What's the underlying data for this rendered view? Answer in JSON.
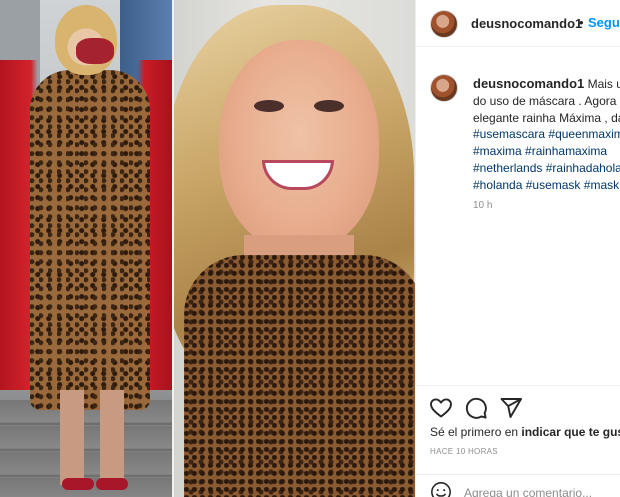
{
  "post": {
    "username": "deusnocomando1",
    "dot": "•",
    "follow_label": "Seguir"
  },
  "caption": {
    "username": "deusnocomando1",
    "lines": [
      "Mais um",
      "do uso de máscara . Agora v",
      "elegante rainha Máxima , da"
    ],
    "hashtag_lines": [
      [
        "#usemascara",
        "#queenmaxim"
      ],
      [
        "#maxima",
        "#rainhamaxima"
      ],
      [
        "#netherlands",
        "#rainhadahola"
      ],
      [
        "#holanda",
        "#usemask",
        "#mask"
      ]
    ],
    "time_ago": "10 h"
  },
  "actions": {
    "like_icon": "heart-icon",
    "comment_icon": "comment-icon",
    "share_icon": "send-icon"
  },
  "likes": {
    "prefix": "Sé el primero en",
    "bold": "indicar que te gus"
  },
  "post_date": "HACE 10 HORAS",
  "comment": {
    "placeholder": "Agrega un comentario..."
  },
  "colors": {
    "accent": "#0095f6",
    "hashtag": "#00376b",
    "muted": "#8e8e8e",
    "text": "#262626"
  }
}
